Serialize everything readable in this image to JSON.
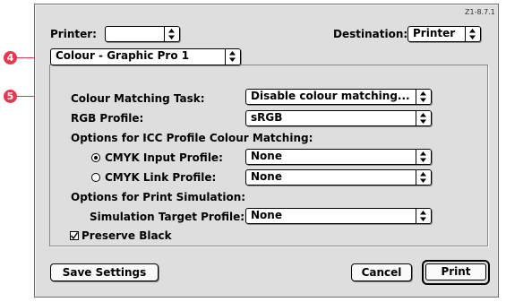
{
  "version": "Z1-8.7.1",
  "printer": {
    "label": "Printer:",
    "value": ""
  },
  "destination": {
    "label": "Destination:",
    "value": "Printer"
  },
  "panel": {
    "value": "Colour - Graphic Pro 1"
  },
  "callouts": {
    "panel": "4",
    "task": "5"
  },
  "colour_matching_task": {
    "label": "Colour Matching Task:",
    "value": "Disable colour matching..."
  },
  "rgb_profile": {
    "label": "RGB Profile:",
    "value": "sRGB"
  },
  "icc_heading": "Options for ICC Profile Colour Matching:",
  "cmyk_input": {
    "label": "CMYK Input Profile:",
    "value": "None",
    "selected": true
  },
  "cmyk_link": {
    "label": "CMYK Link Profile:",
    "value": "None",
    "selected": false
  },
  "print_sim_heading": "Options for Print Simulation:",
  "simulation_target": {
    "label": "Simulation Target Profile:",
    "value": "None"
  },
  "preserve_black": {
    "label": "Preserve Black",
    "checked": true
  },
  "buttons": {
    "save": "Save Settings",
    "cancel": "Cancel",
    "print": "Print"
  },
  "colors": {
    "callout": "#e8384f",
    "dialog_bg": "#dedede"
  }
}
